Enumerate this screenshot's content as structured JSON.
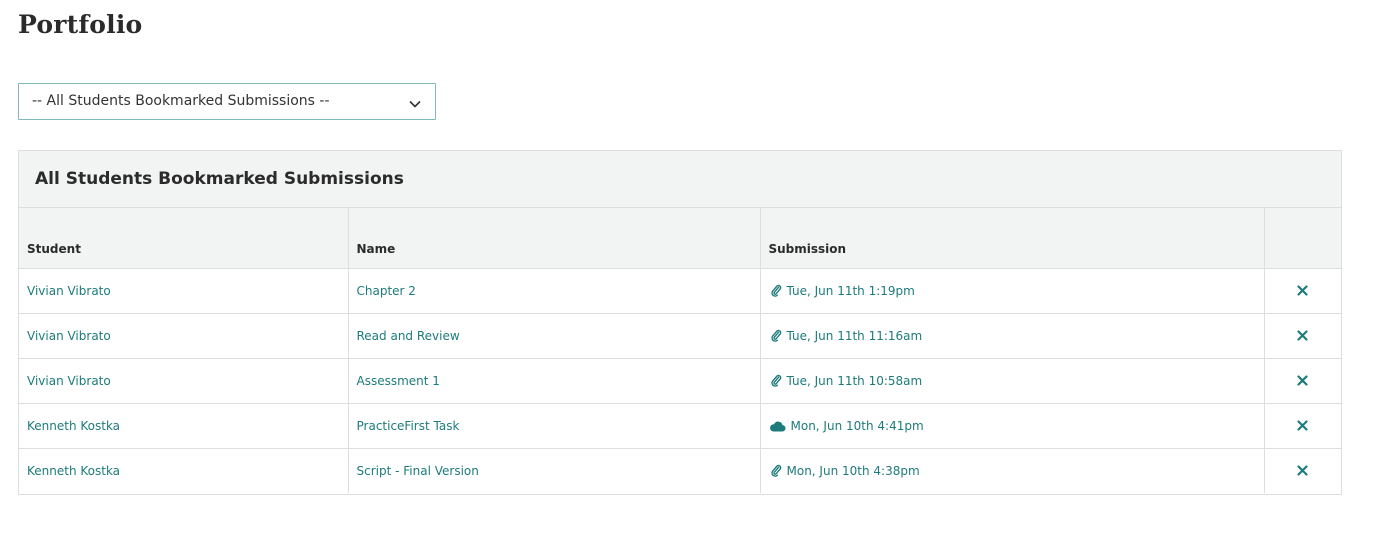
{
  "page": {
    "title": "Portfolio"
  },
  "filter": {
    "selected": "-- All Students Bookmarked Submissions --"
  },
  "panel": {
    "title": "All Students Bookmarked Submissions"
  },
  "table": {
    "columns": [
      "Student",
      "Name",
      "Submission",
      ""
    ],
    "rows": [
      {
        "student": "Vivian Vibrato",
        "name": "Chapter 2",
        "submission": "Tue, Jun 11th 1:19pm",
        "icon": "paperclip-icon"
      },
      {
        "student": "Vivian Vibrato",
        "name": "Read and Review",
        "submission": "Tue, Jun 11th 11:16am",
        "icon": "paperclip-icon"
      },
      {
        "student": "Vivian Vibrato",
        "name": "Assessment 1",
        "submission": "Tue, Jun 11th 10:58am",
        "icon": "paperclip-icon"
      },
      {
        "student": "Kenneth Kostka",
        "name": "PracticeFirst Task",
        "submission": "Mon, Jun 10th 4:41pm",
        "icon": "cloud-icon"
      },
      {
        "student": "Kenneth Kostka",
        "name": "Script - Final Version",
        "submission": "Mon, Jun 10th 4:38pm",
        "icon": "paperclip-icon"
      }
    ]
  },
  "colors": {
    "link": "#1d7b7c",
    "header_bg": "#f2f4f3",
    "border": "#dcdfdf",
    "select_border": "#7fb8bd"
  }
}
